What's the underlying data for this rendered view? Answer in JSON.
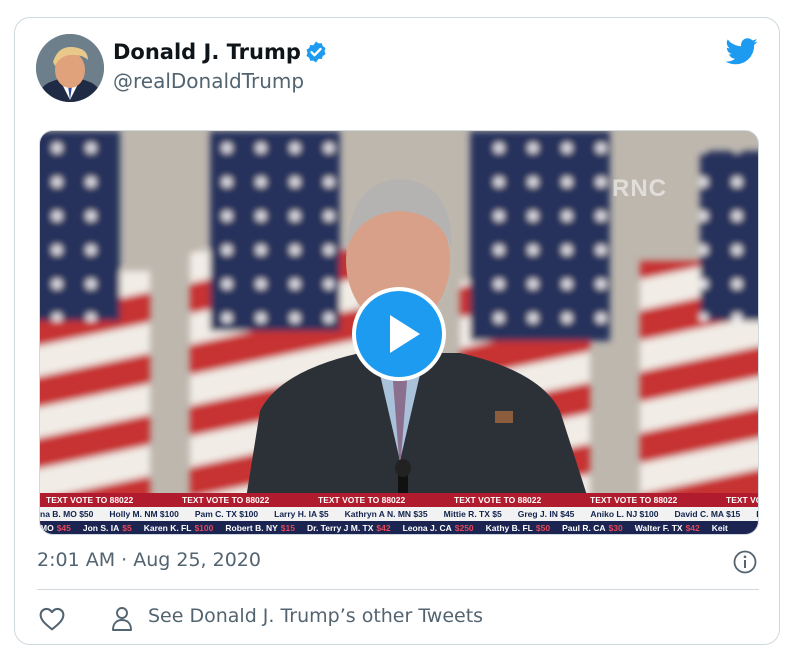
{
  "tweet": {
    "display_name": "Donald J. Trump",
    "handle": "@realDonaldTrump",
    "verified": true,
    "timestamp": "2:01 AM · Aug 25, 2020",
    "other_tweets_link": "See Donald J. Trump’s other Tweets"
  },
  "media": {
    "type": "video",
    "watermark": "RNC",
    "ticker": {
      "banner_text": "TEXT VOTE TO 88022",
      "banner_repeat": [
        "TEXT VOTE TO 88022",
        "TEXT VOTE TO 88022",
        "TEXT VOTE TO 88022",
        "TEXT VOTE TO 88022",
        "TEXT VOTE TO 88022",
        "TEXT VOTE TO"
      ],
      "donors_row_1": [
        "na B. MO $50",
        "Holly M. NM $100",
        "Pam C. TX $100",
        "Larry H. IA $5",
        "Kathryn A N. MN $35",
        "Mittie R. TX $5",
        "Greg J. IN $45",
        "Aniko L. NJ $100",
        "David C. MA $15",
        "Ky"
      ],
      "donors_row_2": [
        {
          "name": "MO",
          "amount": "$45"
        },
        {
          "name": "Jon S. IA",
          "amount": "$5"
        },
        {
          "name": "Karen K. FL",
          "amount": "$100"
        },
        {
          "name": "Robert B. NY",
          "amount": "$15"
        },
        {
          "name": "Dr. Terry J M. TX",
          "amount": "$42"
        },
        {
          "name": "Leona J. CA",
          "amount": "$250"
        },
        {
          "name": "Kathy B. FL",
          "amount": "$50"
        },
        {
          "name": "Paul R. CA",
          "amount": "$30"
        },
        {
          "name": "Walter F. TX",
          "amount": "$42"
        },
        {
          "name": "Keit",
          "amount": ""
        }
      ]
    }
  },
  "colors": {
    "accent": "#1d9bf0",
    "text_primary": "#0f1419",
    "text_secondary": "#536471",
    "border": "#cfd9de"
  },
  "icons": [
    "verified-badge-icon",
    "twitter-bird-icon",
    "play-icon",
    "info-icon",
    "heart-icon",
    "person-icon"
  ]
}
